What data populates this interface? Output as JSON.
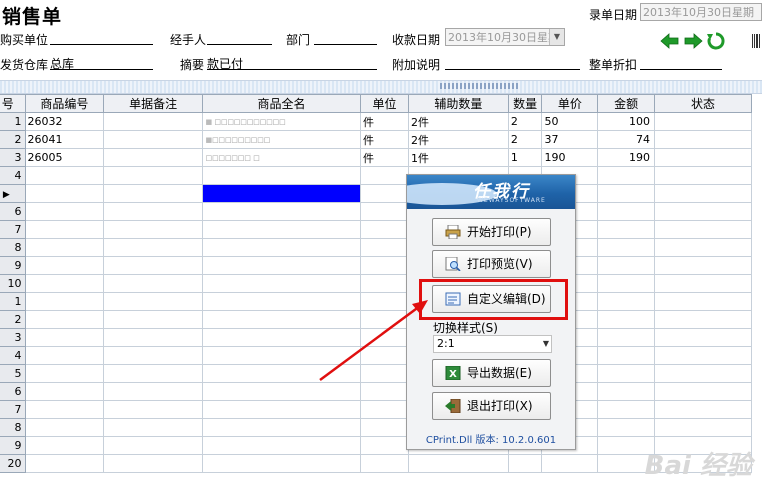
{
  "header": {
    "title": "销售单",
    "record_date_label": "录单日期",
    "record_date_value": "2013年10月30日星期",
    "buyer_label": "购买单位",
    "buyer_value": "",
    "handler_label": "经手人",
    "handler_value": "",
    "dept_label": "部门",
    "dept_value": "",
    "pay_date_label": "收款日期",
    "pay_date_value": "2013年10月30日星期",
    "warehouse_label": "发货仓库",
    "warehouse_value": "总库",
    "summary_label": "摘要",
    "summary_value": "款已付",
    "note_label": "附加说明",
    "note_value": "",
    "discount_label": "整单折扣",
    "discount_value": ""
  },
  "grid": {
    "columns": [
      "号",
      "商品编号",
      "单据备注",
      "商品全名",
      "单位",
      "辅助数量",
      "数量",
      "单价",
      "金额",
      "状态"
    ],
    "rows": [
      {
        "n": "1",
        "code": "26032",
        "note": "",
        "name": "",
        "unit": "件",
        "aux": "2件",
        "qty": "2",
        "price": "50",
        "amount": "100",
        "status": ""
      },
      {
        "n": "2",
        "code": "26041",
        "note": "",
        "name": "",
        "unit": "件",
        "aux": "2件",
        "qty": "2",
        "price": "37",
        "amount": "74",
        "status": ""
      },
      {
        "n": "3",
        "code": "26005",
        "note": "",
        "name": "",
        "unit": "件",
        "aux": "1件",
        "qty": "1",
        "price": "190",
        "amount": "190",
        "status": ""
      }
    ],
    "empty_row_numbers": [
      "4",
      "5",
      "6",
      "7",
      "8",
      "9",
      "10",
      "1",
      "2",
      "3",
      "4",
      "5",
      "6",
      "7",
      "8",
      "9",
      "20"
    ]
  },
  "popup": {
    "logo_text": "任我行",
    "logo_sub": "WEWAYSOFTWARE",
    "btn_print": "开始打印(P)",
    "btn_preview": "打印预览(V)",
    "btn_custom": "自定义编辑(D)",
    "switch_label": "切换样式(S)",
    "switch_value": "2:1",
    "btn_export": "导出数据(E)",
    "btn_exit": "退出打印(X)",
    "version": "CPrint.Dll 版本: 10.2.0.601"
  },
  "watermark": "Bai 经验",
  "colors": {
    "highlight": "#0000ff",
    "annotation_red": "#e00f0f",
    "nav_arrow_green": "#1f9a2a"
  }
}
